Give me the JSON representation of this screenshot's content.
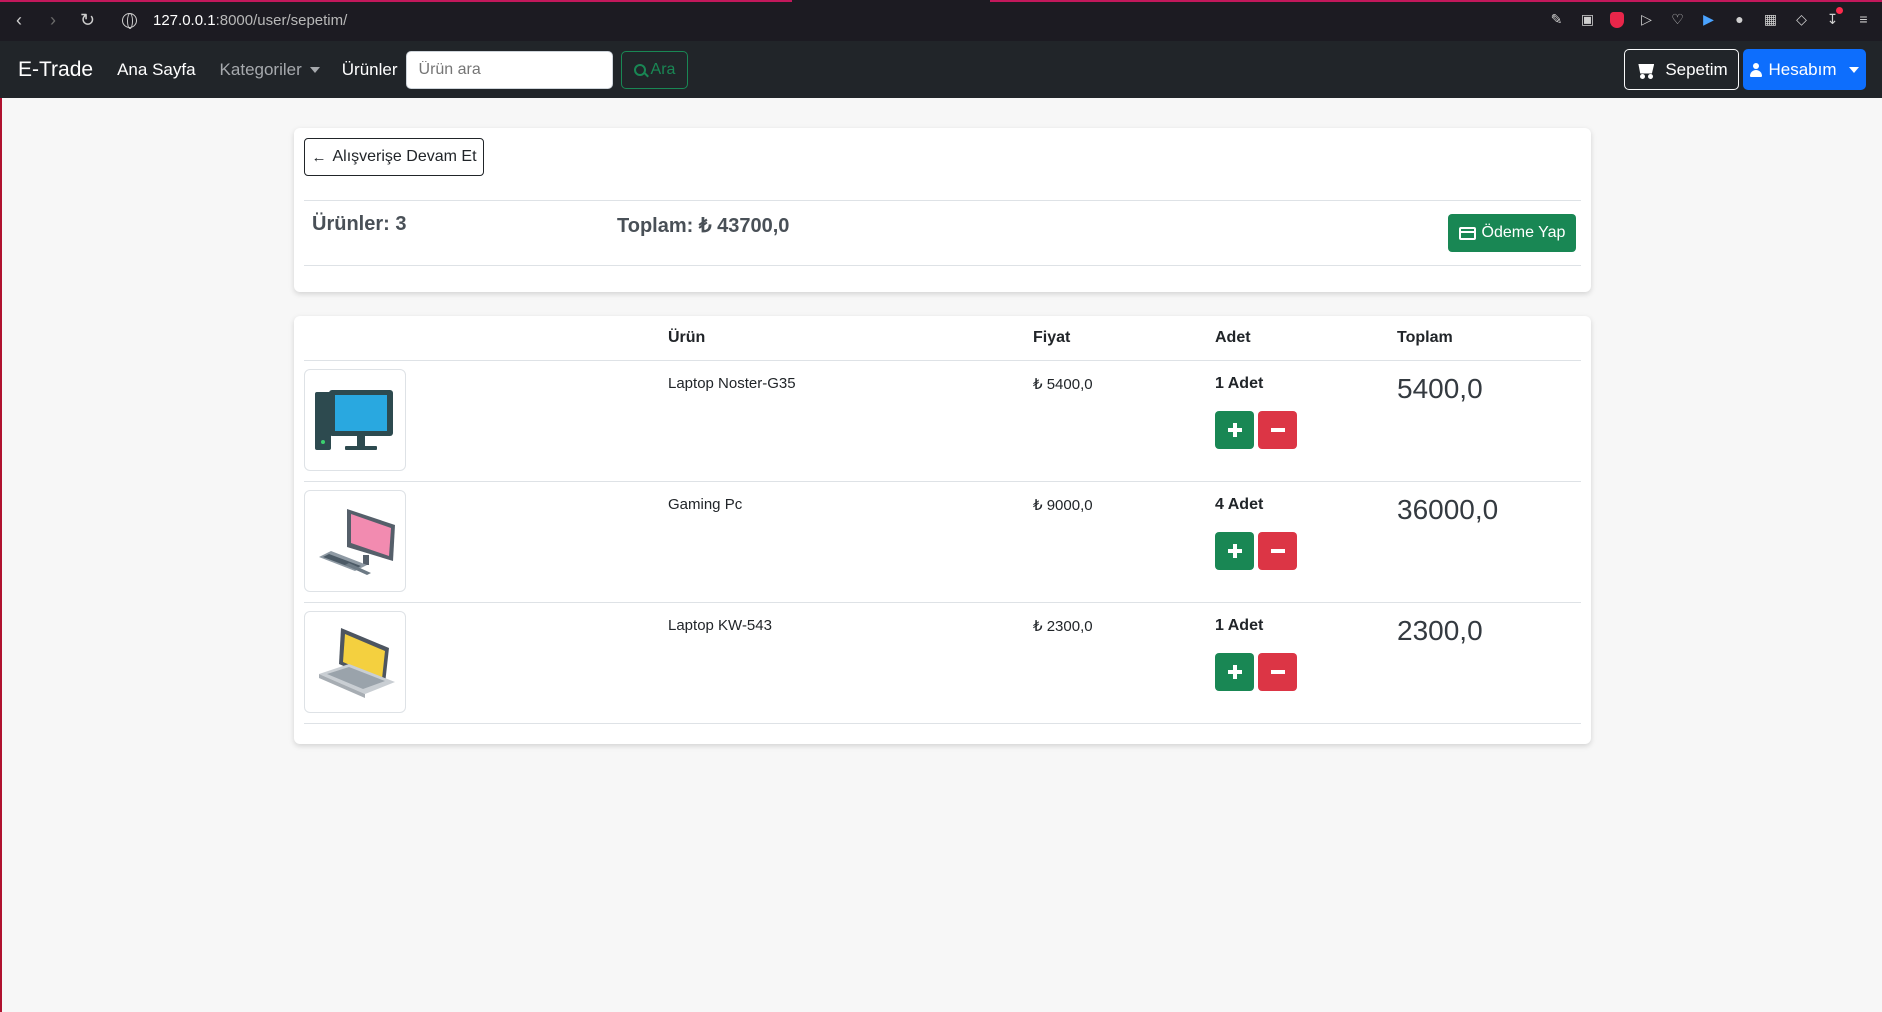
{
  "browser": {
    "url_host": "127.0.0.1",
    "url_path": ":8000/user/sepetim/"
  },
  "navbar": {
    "brand": "E-Trade",
    "home": "Ana Sayfa",
    "categories": "Kategoriler",
    "products": "Ürünler",
    "search_placeholder": "Ürün ara",
    "search_button": "Ara",
    "cart_button": "Sepetim",
    "account_button": "Hesabım"
  },
  "summary": {
    "back_button": "Alışverişe Devam Et",
    "products_count": "Ürünler: 3",
    "total": "Toplam: ₺ 43700,0",
    "pay_button": "Ödeme Yap"
  },
  "table": {
    "headers": [
      "Ürün",
      "Fiyat",
      "Adet",
      "Toplam"
    ],
    "rows": [
      {
        "image": "desktop-computer-icon",
        "name": "Laptop Noster-G35",
        "price": "₺ 5400,0",
        "qty": "1 Adet",
        "total": "5400,0"
      },
      {
        "image": "gaming-pc-icon",
        "name": "Gaming Pc",
        "price": "₺ 9000,0",
        "qty": "4 Adet",
        "total": "36000,0"
      },
      {
        "image": "laptop-icon",
        "name": "Laptop KW-543",
        "price": "₺ 2300,0",
        "qty": "1 Adet",
        "total": "2300,0"
      }
    ]
  },
  "colors": {
    "navbar_bg": "#212529",
    "success": "#198754",
    "danger": "#dc3545",
    "primary": "#0d6efd"
  }
}
